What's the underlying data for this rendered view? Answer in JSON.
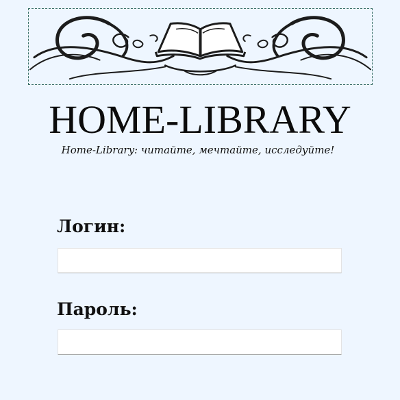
{
  "header": {
    "banner_icon": "open-book-ornament",
    "title": "HOME-LIBRARY",
    "tagline": "Home-Library: читайте, мечтайте, исследуйте!"
  },
  "form": {
    "login": {
      "label": "Логин:",
      "value": "",
      "placeholder": ""
    },
    "password": {
      "label": "Пароль:",
      "value": "",
      "placeholder": ""
    }
  },
  "colors": {
    "background": "#eef6ff",
    "banner_border": "#3a6f6a",
    "text": "#111111"
  }
}
